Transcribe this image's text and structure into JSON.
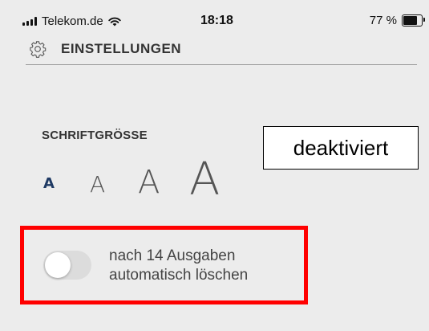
{
  "status_bar": {
    "carrier": "Telekom.de",
    "time": "18:18",
    "battery": "77 %",
    "battery_level": 0.77
  },
  "header": {
    "title": "EINSTELLUNGEN",
    "icon": "gear-icon"
  },
  "font_size": {
    "label": "SCHRIFTGRÖSSE",
    "options": [
      "A",
      "A",
      "A",
      "A"
    ],
    "selected_index": 0,
    "selected_color": "#1f3a64"
  },
  "annotation": {
    "status_text": "deaktiviert"
  },
  "auto_delete": {
    "label_line1": "nach 14 Ausgaben",
    "label_line2": "automatisch löschen",
    "enabled": false,
    "highlight_color": "#ff0000"
  }
}
